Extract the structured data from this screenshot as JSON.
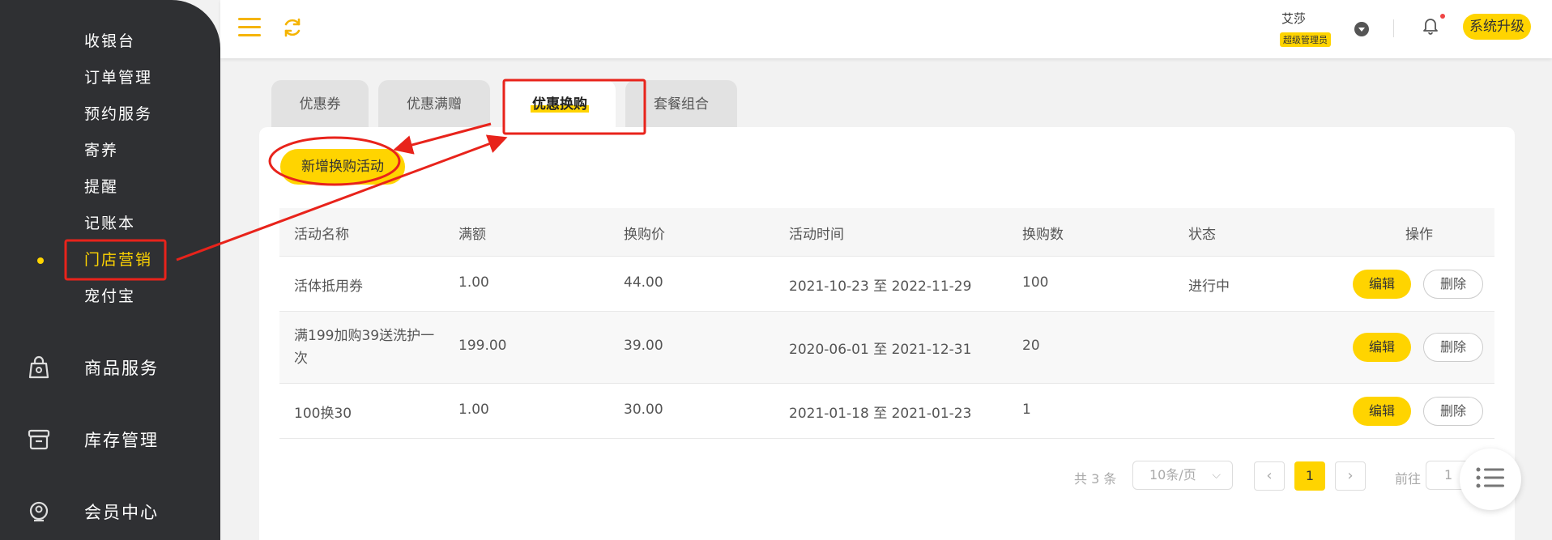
{
  "sidebar": {
    "sub_items": [
      {
        "label": "收银台"
      },
      {
        "label": "订单管理"
      },
      {
        "label": "预约服务"
      },
      {
        "label": "寄养"
      },
      {
        "label": "提醒"
      },
      {
        "label": "记账本"
      },
      {
        "label": "门店营销",
        "active": true
      },
      {
        "label": "宠付宝"
      }
    ],
    "main_items": [
      {
        "label": "商品服务",
        "icon": "bag-icon"
      },
      {
        "label": "库存管理",
        "icon": "archive-box-icon"
      },
      {
        "label": "会员中心",
        "icon": "member-icon"
      }
    ]
  },
  "header": {
    "user_name": "艾莎",
    "user_role": "超级管理员",
    "upgrade_label": "系统升级"
  },
  "tabs": [
    {
      "label": "优惠券"
    },
    {
      "label": "优惠满赠"
    },
    {
      "label": "优惠换购",
      "active": true
    },
    {
      "label": "套餐组合"
    }
  ],
  "add_button_label": "新增换购活动",
  "table": {
    "columns": [
      "活动名称",
      "满额",
      "换购价",
      "活动时间",
      "换购数",
      "状态",
      "操作"
    ],
    "rows": [
      {
        "name": "活体抵用券",
        "threshold": "1.00",
        "price": "44.00",
        "time": "2021-10-23 至 2022-11-29",
        "count": "100",
        "status": "进行中"
      },
      {
        "name": "满199加购39送洗护一次",
        "threshold": "199.00",
        "price": "39.00",
        "time": "2020-06-01 至 2021-12-31",
        "count": "20",
        "status": ""
      },
      {
        "name": "100换30",
        "threshold": "1.00",
        "price": "30.00",
        "time": "2021-01-18 至 2021-01-23",
        "count": "1",
        "status": ""
      }
    ],
    "edit_label": "编辑",
    "delete_label": "删除"
  },
  "pagination": {
    "total": "共 3 条",
    "page_size": "10条/页",
    "current_page": "1",
    "goto_label": "前往",
    "goto_value": "1"
  },
  "colors": {
    "accent": "#ffd400",
    "sidebar_bg": "#2f3033",
    "annotation_red": "#e8231b"
  }
}
